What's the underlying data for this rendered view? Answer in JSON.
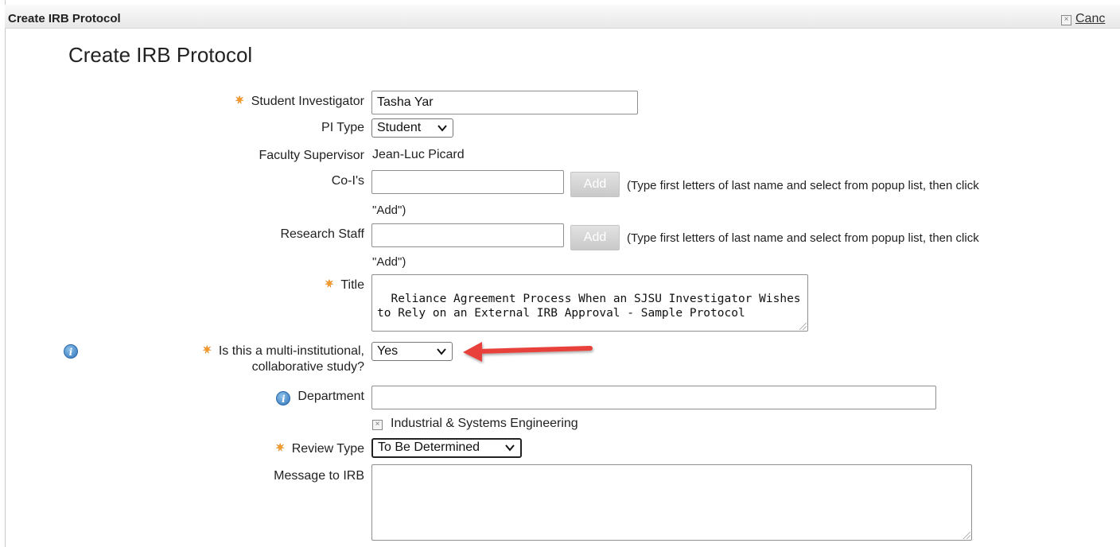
{
  "window": {
    "title": "Create IRB Protocol",
    "cancel_label": "Canc"
  },
  "page": {
    "heading": "Create IRB Protocol"
  },
  "form": {
    "student_investigator": {
      "label": "Student Investigator",
      "value": "Tasha Yar",
      "required": true
    },
    "pi_type": {
      "label": "PI Type",
      "selected": "Student"
    },
    "faculty_supervisor": {
      "label": "Faculty Supervisor",
      "value": "Jean-Luc Picard"
    },
    "co_is": {
      "label": "Co-I's",
      "value": "",
      "add_label": "Add",
      "hint_line1": "(Type first letters of last name and select from popup list, then click",
      "hint_line2": "\"Add\")"
    },
    "research_staff": {
      "label": "Research Staff",
      "value": "",
      "add_label": "Add",
      "hint_line1": "(Type first letters of last name and select from popup list, then click",
      "hint_line2": "\"Add\")"
    },
    "title": {
      "label": "Title",
      "required": true,
      "value": "Reliance Agreement Process When an SJSU Investigator Wishes to Rely on an External IRB Approval - Sample Protocol"
    },
    "multi_institutional": {
      "label_line1": "Is this a multi-institutional,",
      "label_line2": "collaborative study?",
      "selected": "Yes",
      "required": true
    },
    "department": {
      "label": "Department",
      "value": "",
      "selected_item": "Industrial & Systems Engineering"
    },
    "review_type": {
      "label": "Review Type",
      "selected": "To Be Determined",
      "required": true
    },
    "message_to_irb": {
      "label": "Message to IRB",
      "value": ""
    }
  },
  "annotation": {
    "arrow_color": "#e8413a"
  },
  "colors": {
    "required_icon": "#e0801a",
    "info_icon": "#3b7fc4"
  },
  "icons": {
    "required": "asterisk-icon",
    "info": "info-icon",
    "remove": "close-box-icon",
    "dropdown": "chevron-down-icon"
  }
}
